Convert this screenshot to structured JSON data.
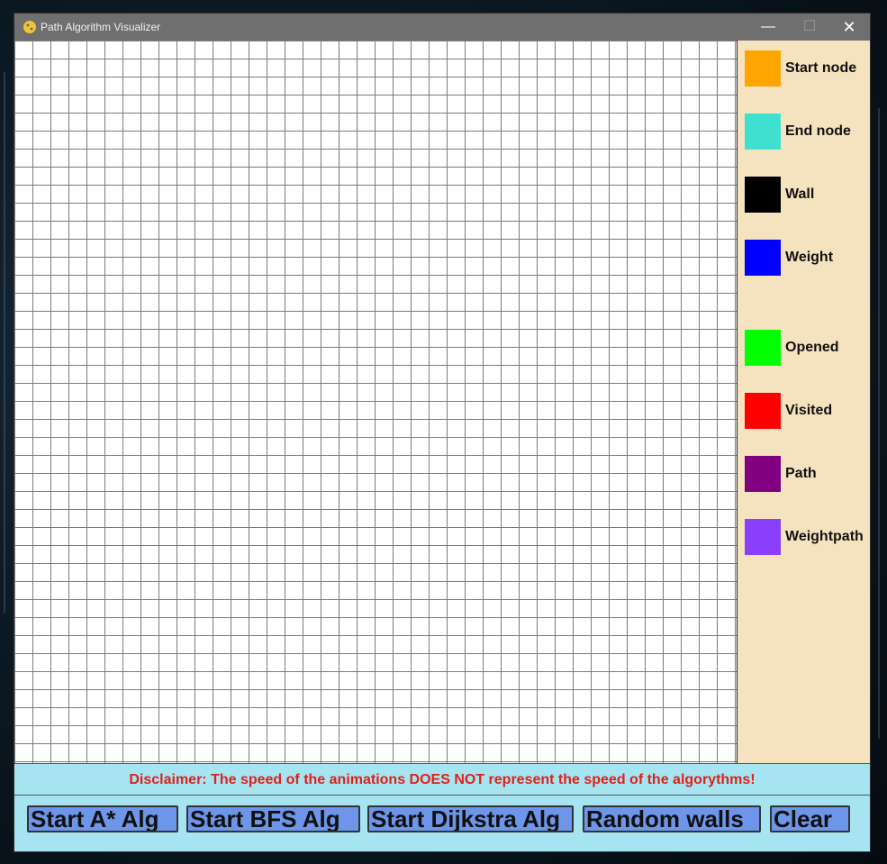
{
  "window": {
    "title": "Path Algorithm Visualizer"
  },
  "titlebar_controls": {
    "minimize": "—",
    "maximize": "☐",
    "close": "✕"
  },
  "legend": [
    {
      "label": "Start node",
      "color": "#ffa500"
    },
    {
      "label": "End node",
      "color": "#40e0d0"
    },
    {
      "label": "Wall",
      "color": "#000000"
    },
    {
      "label": "Weight",
      "color": "#0000ff"
    },
    {
      "label": "Opened",
      "color": "#00ff00"
    },
    {
      "label": "Visited",
      "color": "#ff0000"
    },
    {
      "label": "Path",
      "color": "#800080"
    },
    {
      "label": "Weightpath",
      "color": "#8a3ffc"
    }
  ],
  "disclaimer": "Disclaimer: The speed of the animations DOES NOT represent the speed of the algorythms!",
  "buttons": [
    {
      "label": "Start A* Alg"
    },
    {
      "label": "Start BFS Alg"
    },
    {
      "label": "Start Dijkstra Alg"
    },
    {
      "label": "Random walls"
    },
    {
      "label": "Clear"
    }
  ],
  "colors": {
    "titlebar": "#6f6f6f",
    "legend_bg": "#f5e3bf",
    "bottom_bg": "#a6e4f2",
    "button_bg": "#6d96ea",
    "disclaimer_text": "#e0201a",
    "grid_line": "#7b7b7b"
  }
}
